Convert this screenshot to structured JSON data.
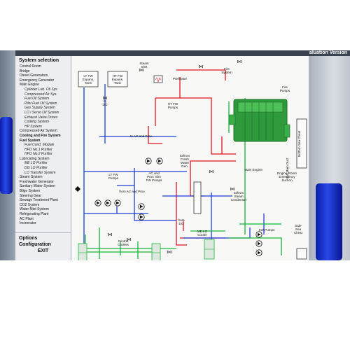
{
  "header": {
    "eval_text": "aluation Version"
  },
  "sidebar": {
    "title": "System selection",
    "items": [
      {
        "label": "Control Room",
        "sub": false,
        "sel": false
      },
      {
        "label": "Bridge",
        "sub": false,
        "sel": false
      },
      {
        "label": "Diesel Generators",
        "sub": false,
        "sel": false
      },
      {
        "label": "Emergency Generator",
        "sub": false,
        "sel": false
      },
      {
        "label": "Main Engine",
        "sub": false,
        "sel": false
      },
      {
        "label": "Cylinder Lub. Oil Sys.",
        "sub": true,
        "sel": false
      },
      {
        "label": "Compressed Air Sys.",
        "sub": true,
        "sel": false
      },
      {
        "label": "Fuel Oil System",
        "sub": true,
        "sel": false
      },
      {
        "label": "Pilot Fuel Oil System",
        "sub": true,
        "sel": false
      },
      {
        "label": "Gas Supply System",
        "sub": true,
        "sel": false
      },
      {
        "label": "LO / Servo Oil System",
        "sub": true,
        "sel": false
      },
      {
        "label": "Exhaust Valve Drives",
        "sub": true,
        "sel": false
      },
      {
        "label": "Cooling System",
        "sub": true,
        "sel": false
      },
      {
        "label": "HP System",
        "sub": true,
        "sel": false
      },
      {
        "label": "Compressed Air System",
        "sub": false,
        "sel": false
      },
      {
        "label": "Cooling and Fire System",
        "sub": false,
        "sel": true
      },
      {
        "label": "Fuel System",
        "sub": false,
        "sel": true
      },
      {
        "label": "Fuel Cond. Module",
        "sub": true,
        "sel": false
      },
      {
        "label": "HFO No.1 Purifier",
        "sub": true,
        "sel": false
      },
      {
        "label": "HFO No.2 Purifier",
        "sub": true,
        "sel": false
      },
      {
        "label": "Lubricating System",
        "sub": false,
        "sel": false
      },
      {
        "label": "ME LO Purifier",
        "sub": true,
        "sel": false
      },
      {
        "label": "DG LO Purifier",
        "sub": true,
        "sel": false
      },
      {
        "label": "LO Transfer System",
        "sub": true,
        "sel": false
      },
      {
        "label": "Steam System",
        "sub": false,
        "sel": false
      },
      {
        "label": "Freshwater Generator",
        "sub": false,
        "sel": false
      },
      {
        "label": "Sanitary Water System",
        "sub": false,
        "sel": false
      },
      {
        "label": "Bilge System",
        "sub": false,
        "sel": false
      },
      {
        "label": "Steering Gear",
        "sub": false,
        "sel": false
      },
      {
        "label": "Sewage Treatment Plant",
        "sub": false,
        "sel": false
      },
      {
        "label": "CO2 System",
        "sub": false,
        "sel": false
      },
      {
        "label": "Water Mist System",
        "sub": false,
        "sel": false
      },
      {
        "label": "Refrigerating Plant",
        "sub": false,
        "sel": false
      },
      {
        "label": "AC Plant",
        "sub": false,
        "sel": false
      },
      {
        "label": "Incinerator",
        "sub": false,
        "sel": false
      }
    ],
    "options_label": "Options",
    "configuration_label": "Configuration",
    "exit_label": "EXIT"
  },
  "diagram": {
    "lt_fw_tank": "LT FW\nExpans.\nTank",
    "ht_fw_tank": "HT FW\nExpans.\nTank",
    "steam_inlet": "Steam\nInlet",
    "preheater": "Preheater",
    "ht_fw_pumps": "HT FW\nPumps",
    "to_do_top": "to\nDO",
    "fire_system": "Fire\nSystem",
    "fire_pumps": "Fire\nPumps",
    "bottom_sea_chest": "Bottom Sea Chest",
    "sw_main_duct": "SW Main Duct",
    "to_ac_and_prov": "to AC and Prov.",
    "main_engine": "Main Engine",
    "lt_fw_pumps": "LT FW\nPumps",
    "ac_prov_pumps": "AC and\nProv. Shn\nFW Pumps",
    "to_from_fresh_water_gen": "to/from\nFresh\nWater\nGen.",
    "engine_room_suction": "Engine Room\nEmergency\nSuction",
    "from_ac_and_prov": "from AC and Prov.",
    "to_from_steam_condenser": "to/from\nSteam\nCondenser",
    "central_coolers": "Central\nCoolers",
    "from_do": "from\nDO",
    "me_lo_cooler": "ME LO\nCooler",
    "sw_pumps": "SW Pumps",
    "side_sea_chest": "Side\nSea\nChest"
  },
  "colors": {
    "freshwater_ht": "#e0141e",
    "freshwater_lt": "#1a3ed8",
    "seawater": "#18b43a",
    "engine": "#2e9a3c",
    "sidebar_bg": "#eceef1"
  }
}
